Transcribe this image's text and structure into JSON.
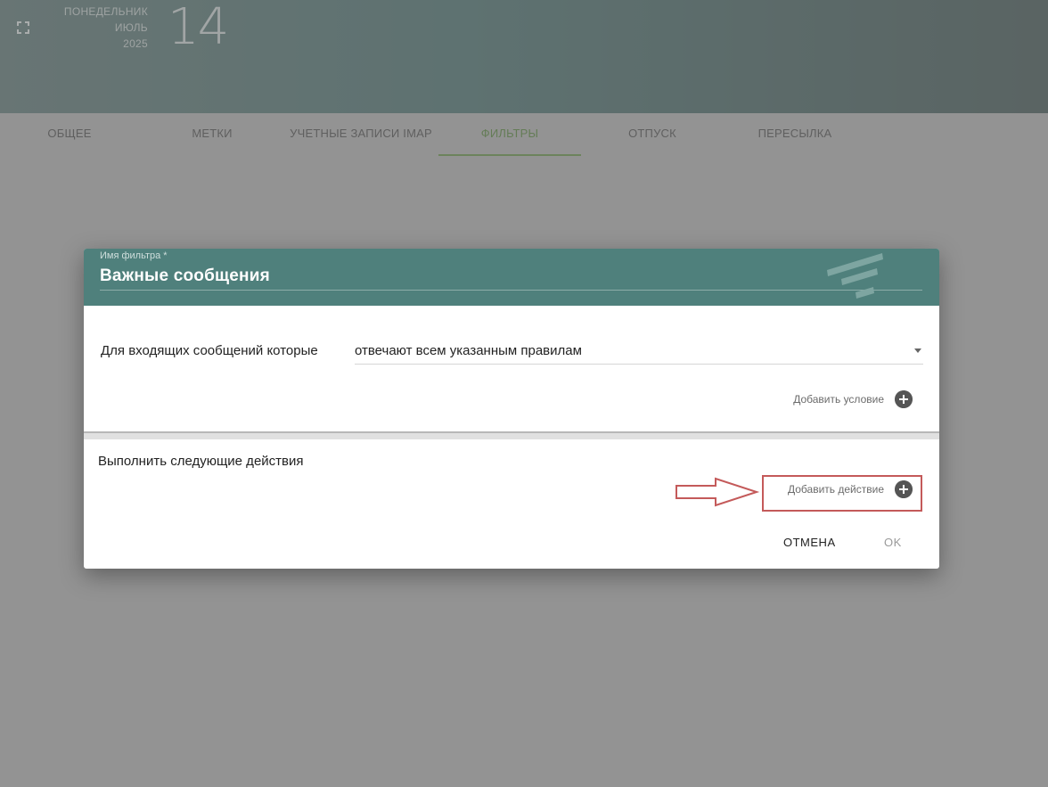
{
  "header": {
    "weekday": "ПОНЕДЕЛЬНИК",
    "month": "ИЮЛЬ",
    "year": "2025",
    "day": "14"
  },
  "tabs": [
    {
      "label": "ОБЩЕЕ",
      "active": false
    },
    {
      "label": "МЕТКИ",
      "active": false
    },
    {
      "label": "УЧЕТНЫЕ ЗАПИСИ IMAP",
      "active": false
    },
    {
      "label": "ФИЛЬТРЫ",
      "active": true
    },
    {
      "label": "ОТПУСК",
      "active": false
    },
    {
      "label": "ПЕРЕСЫЛКА",
      "active": false
    }
  ],
  "dialog": {
    "name_label": "Имя фильтра *",
    "name_value": "Важные сообщения",
    "condition_label": "Для входящих сообщений которые",
    "condition_value": "отвечают всем указанным правилам",
    "add_condition": "Добавить условие",
    "actions_label": "Выполнить следующие действия",
    "add_action": "Добавить действие",
    "cancel": "ОТМЕНА",
    "ok": "OK"
  },
  "colors": {
    "header_teal": "#4f807c",
    "active_tab": "#5e8f43",
    "highlight": "#c45a5a"
  }
}
